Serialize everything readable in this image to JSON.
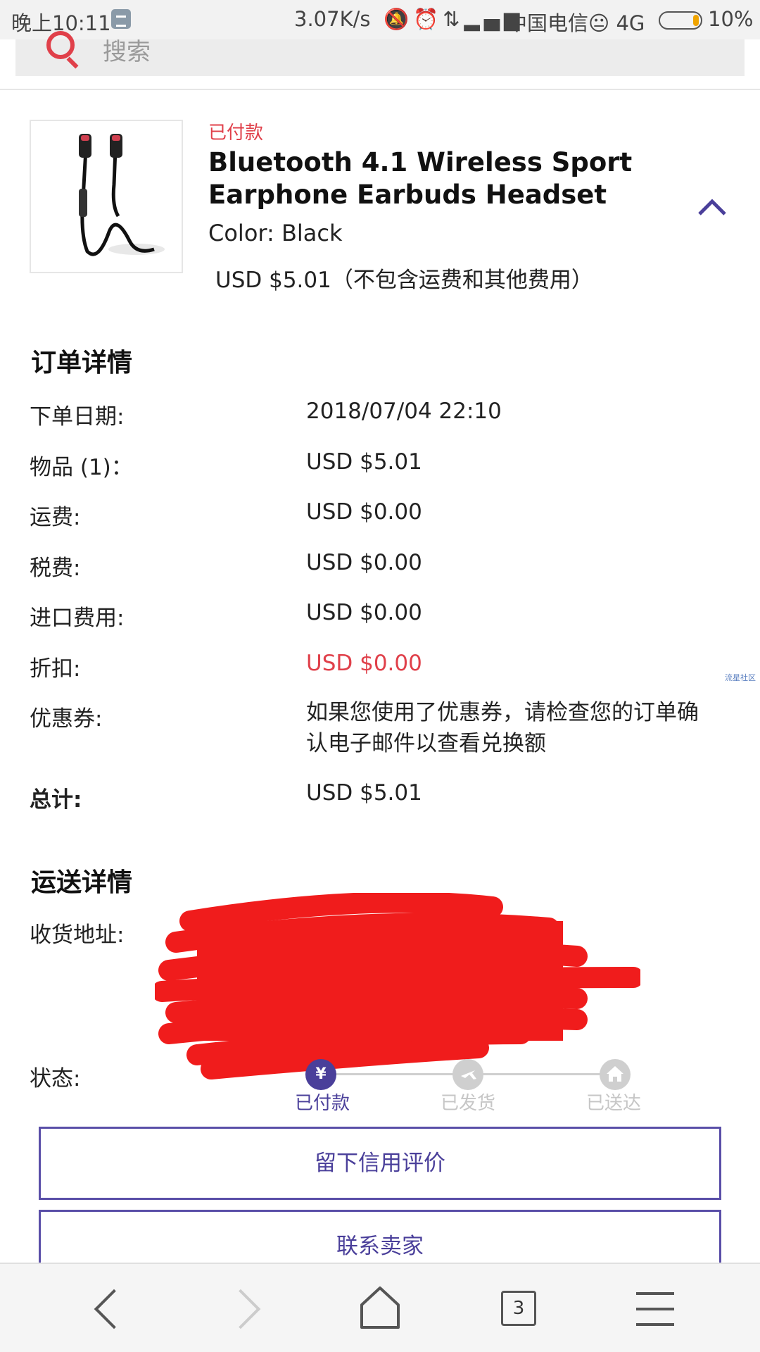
{
  "status_bar": {
    "time": "晚上10:11",
    "speed": "3.07K/s",
    "icons": "🔕⏰⇅▂▄▆",
    "carrier": "中国电信😐 4G",
    "battery": "10%"
  },
  "search": {
    "placeholder": "搜索"
  },
  "product": {
    "status": "已付款",
    "title": "Bluetooth 4.1 Wireless Sport Earphone Earbuds Headset",
    "color": "Color: Black",
    "price": "USD $5.01（不包含运费和其他费用）"
  },
  "order_details": {
    "title": "订单详情",
    "rows": [
      {
        "label": "下单日期:",
        "value": "2018/07/04 22:10"
      },
      {
        "label": "物品 (1)：",
        "value": "USD $5.01"
      },
      {
        "label": "运费:",
        "value": "USD $0.00"
      },
      {
        "label": "税费:",
        "value": "USD $0.00"
      },
      {
        "label": "进口费用:",
        "value": "USD $0.00"
      },
      {
        "label": "折扣:",
        "value": "USD $0.00"
      },
      {
        "label": "优惠券:",
        "value": "如果您使用了优惠券，请检查您的订单确认电子邮件以查看兑换额"
      },
      {
        "label": "总计:",
        "value": "USD $5.01"
      }
    ]
  },
  "watermark": "流星社区",
  "shipping": {
    "title": "运送详情",
    "address_label": "收货地址:",
    "status_label": "状态:",
    "steps": [
      {
        "label": "已付款",
        "icon": "¥",
        "active": true
      },
      {
        "label": "已发货",
        "icon": "plane-icon",
        "active": false
      },
      {
        "label": "已送达",
        "icon": "house-icon",
        "active": false
      }
    ]
  },
  "actions": {
    "feedback": "留下信用评价",
    "contact": "联系卖家"
  },
  "bottom_nav": {
    "tab_count": "3"
  },
  "colors": {
    "accent": "#4a3f9a",
    "alert": "#e0404a",
    "redaction": "#f01c1c"
  }
}
